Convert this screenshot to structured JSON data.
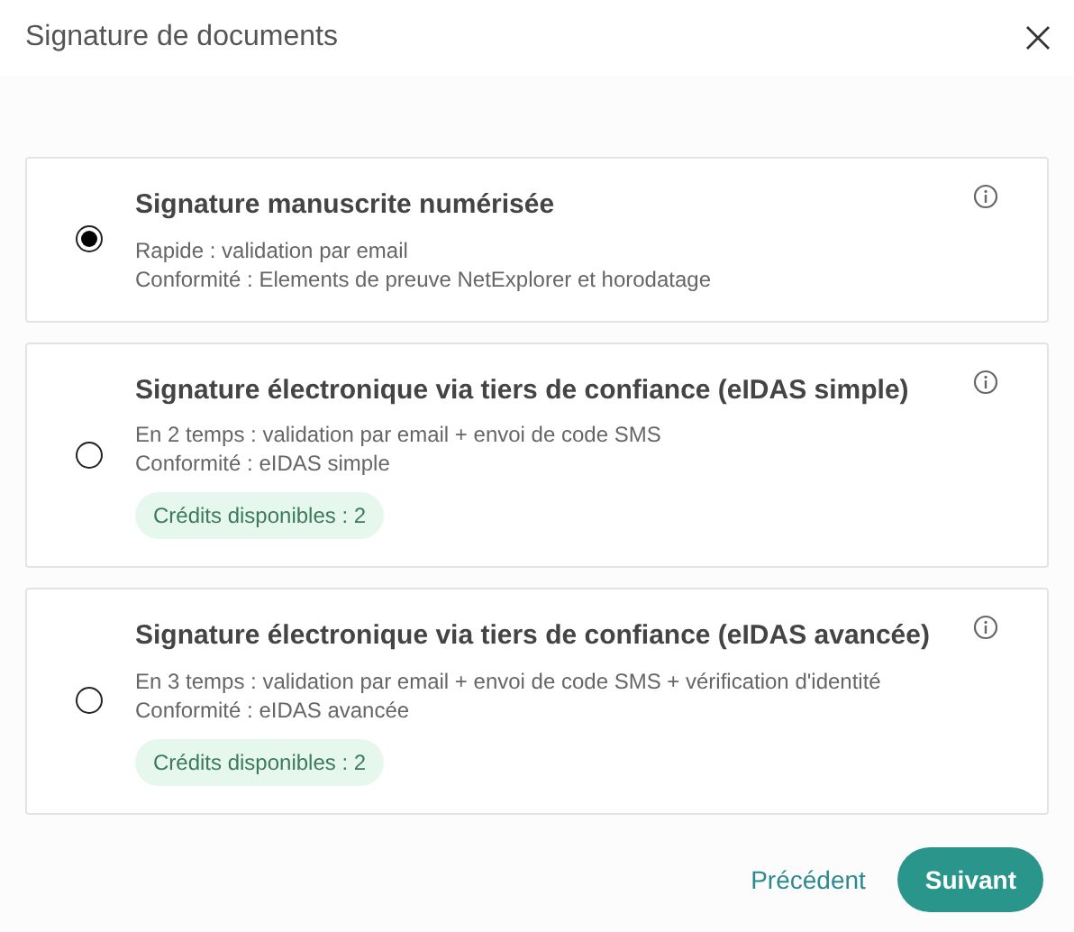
{
  "dialog": {
    "title": "Signature de documents"
  },
  "options": [
    {
      "title": "Signature manuscrite numérisée",
      "lines": [
        "Rapide : validation par email",
        "Conformité : Elements de preuve NetExplorer et horodatage"
      ],
      "selected": true
    },
    {
      "title": "Signature électronique via tiers de confiance (eIDAS simple)",
      "lines": [
        "En 2 temps : validation par email + envoi de code SMS",
        "Conformité : eIDAS simple"
      ],
      "badge": "Crédits disponibles : 2",
      "selected": false
    },
    {
      "title": "Signature électronique via tiers de confiance (eIDAS avancée)",
      "lines": [
        "En 3 temps : validation par email + envoi de code SMS + vérification d'identité",
        "Conformité : eIDAS avancée"
      ],
      "badge": "Crédits disponibles : 2",
      "selected": false
    }
  ],
  "buttons": [
    {
      "label": "Précédent",
      "kind": "link"
    },
    {
      "label": "Suivant",
      "kind": "primary"
    }
  ]
}
